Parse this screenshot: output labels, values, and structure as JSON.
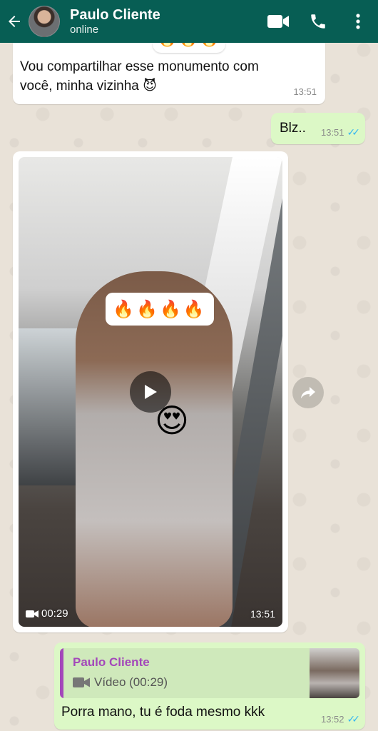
{
  "header": {
    "contact_name": "Paulo Cliente",
    "status": "online",
    "icons": [
      "back-arrow-icon",
      "video-call-icon",
      "phone-icon",
      "more-vert-icon"
    ],
    "bg_color": "#075e54"
  },
  "messages": [
    {
      "type": "text",
      "direction": "in",
      "text_line1": "Vou compartilhar esse monumento com",
      "text_line2": "você, minha vizinha 😈",
      "time": "13:51",
      "reaction": "🔥🔥🔥"
    },
    {
      "type": "text",
      "direction": "out",
      "text": "Blz..",
      "time": "13:51",
      "read": true
    },
    {
      "type": "video",
      "direction": "in",
      "duration": "00:29",
      "time": "13:51",
      "overlay_text": "🔥🔥🔥🔥",
      "sticker": "😍"
    },
    {
      "type": "reply",
      "direction": "out",
      "quote_author": "Paulo Cliente",
      "quote_text": "Vídeo (00:29)",
      "text": "Porra mano, tu é foda mesmo kkk",
      "time": "13:52",
      "read": true
    }
  ],
  "colors": {
    "outgoing_bubble": "#dcf8c6",
    "incoming_bubble": "#ffffff",
    "quote_author": "#a347ba",
    "read_ticks": "#34b7f1"
  }
}
